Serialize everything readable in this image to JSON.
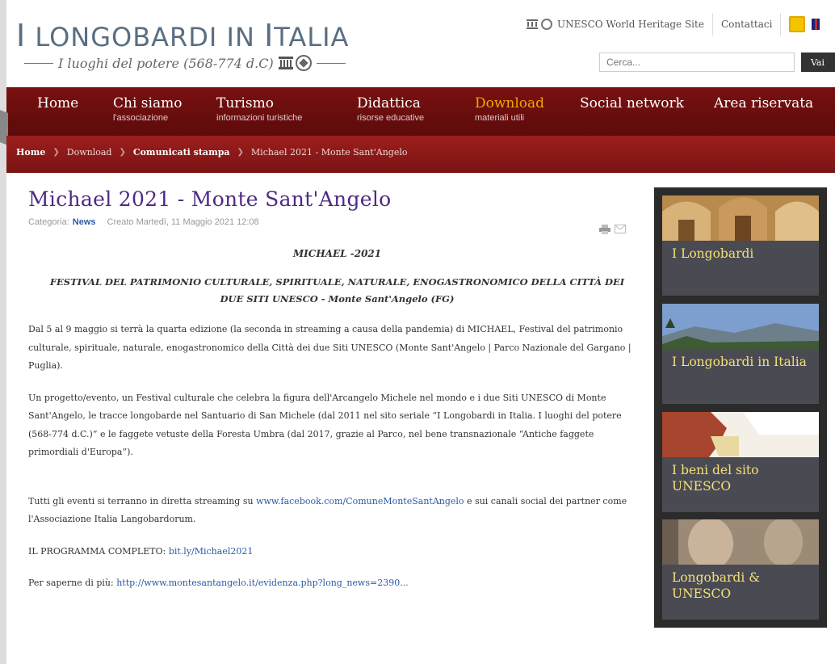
{
  "header": {
    "title_first": "I",
    "title_rest_a": "LONGOBARDI IN ",
    "title_big_i": "I",
    "title_rest_b": "TALIA",
    "tagline": "I luoghi del potere (568-774 d.C)",
    "unesco_label": "UNESCO World Heritage Site",
    "contact_label": "Contattaci",
    "search_placeholder": "Cerca...",
    "search_button": "Vai"
  },
  "nav": [
    {
      "label": "Home",
      "sub": ""
    },
    {
      "label": "Chi siamo",
      "sub": "l'associazione"
    },
    {
      "label": "Turismo",
      "sub": "informazioni turistiche"
    },
    {
      "label": "Didattica",
      "sub": "risorse educative"
    },
    {
      "label": "Download",
      "sub": "materiali utili"
    },
    {
      "label": "Social network",
      "sub": ""
    },
    {
      "label": "Area riservata",
      "sub": ""
    }
  ],
  "breadcrumb": [
    "Home",
    "Download",
    "Comunicati stampa",
    "Michael 2021 - Monte Sant'Angelo"
  ],
  "article": {
    "title": "Michael 2021 - Monte Sant'Angelo",
    "category_label": "Categoria:",
    "category": "News",
    "created": "Creato Martedì, 11 Maggio 2021 12:08",
    "heading": "MICHAEL -2021",
    "subheading_l1": "FESTIVAL DEL PATRIMONIO CULTURALE, SPIRITUALE, NATURALE, ENOGASTRONOMICO DELLA CITTÀ DEI",
    "subheading_l2": "DUE SITI UNESCO - Monte Sant'Angelo (FG)",
    "p1": "Dal 5 al 9 maggio si terrà la quarta edizione (la seconda in streaming a causa della pandemia) di MICHAEL, Festival del patrimonio culturale, spirituale, naturale, enogastronomico della Città dei due Siti UNESCO (Monte Sant'Angelo | Parco Nazionale del Gargano | Puglia).",
    "p2": "Un progetto/evento, un Festival culturale che celebra la figura dell'Arcangelo Michele nel mondo e i due Siti UNESCO di Monte Sant'Angelo, le tracce longobarde nel Santuario di San Michele (dal 2011 nel sito seriale “I Longobardi in Italia. I luoghi del potere (568-774 d.C.)” e le faggete vetuste della Foresta Umbra (dal 2017, grazie al Parco, nel bene transnazionale “Antiche faggete primordiali d'Europa”).",
    "p3_a": "Tutti gli eventi si terranno in diretta streaming su ",
    "p3_link": "www.facebook.com/ComuneMonteSantAngelo",
    "p3_b": " e sui canali social dei partner come l'Associazione Italia Langobardorum.",
    "p4_a": "IL PROGRAMMA COMPLETO: ",
    "p4_link": "bit.ly/Michael2021",
    "p5_a": "Per saperne di più: ",
    "p5_link": "http://www.montesantangelo.it/evidenza.php?long_news=2390..."
  },
  "sidebar": [
    {
      "label": "I Longobardi"
    },
    {
      "label": "I Longobardi in Italia"
    },
    {
      "label": "I beni del sito UNESCO"
    },
    {
      "label": "Longobardi & UNESCO"
    }
  ],
  "colors": {
    "nav_bg": "#6b0e0e",
    "active_nav": "#f0a800",
    "title_purple": "#4e2a84",
    "link_blue": "#2a5aa8",
    "sidebar_label": "#f2e07a"
  }
}
